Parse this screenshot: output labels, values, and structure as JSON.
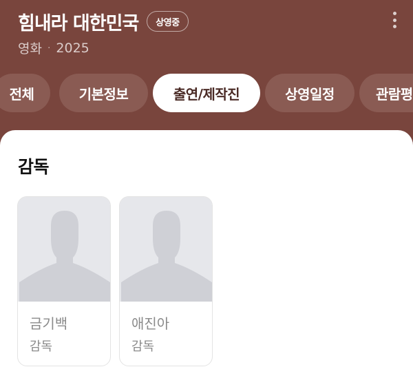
{
  "header": {
    "title": "힘내라 대한민국",
    "status_badge": "상영중",
    "genre": "영화",
    "separator": "·",
    "year": "2025"
  },
  "tabs": [
    {
      "label": "전체",
      "active": false
    },
    {
      "label": "기본정보",
      "active": false
    },
    {
      "label": "출연/제작진",
      "active": true
    },
    {
      "label": "상영일정",
      "active": false
    },
    {
      "label": "관람평",
      "active": false
    }
  ],
  "section": {
    "title": "감독",
    "people": [
      {
        "name": "금기백",
        "role": "감독"
      },
      {
        "name": "애진아",
        "role": "감독"
      }
    ]
  },
  "icons": {
    "more": "more-vertical-icon",
    "avatar": "person-silhouette-icon"
  },
  "colors": {
    "background": "#79453d",
    "tab_inactive": "#8a5b53",
    "tab_active": "#ffffff",
    "placeholder": "#e6e7eb",
    "silhouette": "#cfd0d6"
  }
}
